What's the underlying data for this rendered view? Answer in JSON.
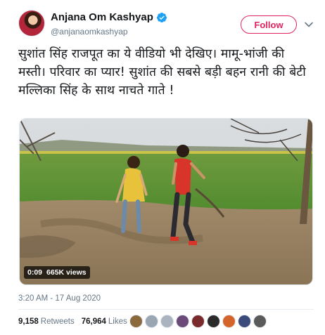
{
  "author": {
    "display_name": "Anjana Om Kashyap",
    "handle": "@anjanaomkashyap"
  },
  "follow_label": "Follow",
  "tweet_text": "सुशांत सिंह राजपूत का ये वीडियो भी देखिए। मामू-भांजी की मस्ती। परिवार का प्यार! सुशांत की सबसे बड़ी बहन रानी की बेटी मल्लिका सिंह के साथ नाचते गाते !",
  "video": {
    "duration": "0:09",
    "views": "665K views"
  },
  "timestamp": "3:20 AM - 17 Aug 2020",
  "stats": {
    "retweets_count": "9,158",
    "retweets_label": "Retweets",
    "likes_count": "76,964",
    "likes_label": "Likes"
  },
  "colors": {
    "accent": "#e0245e",
    "verified": "#1da1f2",
    "muted": "#657786"
  },
  "liker_avatars": [
    {
      "color": "#8a6a3c"
    },
    {
      "color": "#9aa6b2"
    },
    {
      "color": "#aab4be"
    },
    {
      "color": "#6b4a7a"
    },
    {
      "color": "#7a2a2a"
    },
    {
      "color": "#2a2a2a"
    },
    {
      "color": "#d4642a"
    },
    {
      "color": "#3a4a7a"
    },
    {
      "color": "#5a5a5a"
    }
  ]
}
